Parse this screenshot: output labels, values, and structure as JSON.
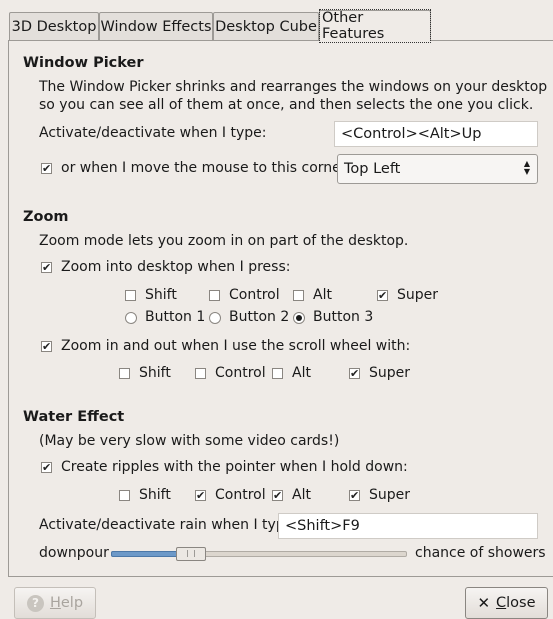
{
  "tabs": [
    {
      "label": "3D Desktop"
    },
    {
      "label": "Window Effects"
    },
    {
      "label": "Desktop Cube"
    },
    {
      "label": "Other Features",
      "active": true
    }
  ],
  "window_picker": {
    "title": "Window Picker",
    "description_line1": "The Window Picker shrinks and rearranges the windows on your desktop",
    "description_line2": "so you can see all of them at once, and then selects the one you click.",
    "activate_label": "Activate/deactivate when I type:",
    "activate_value": "<Control><Alt>Up",
    "corner_checked": true,
    "corner_label": "or when I move the mouse to this corner:",
    "corner_value": "Top Left"
  },
  "zoom": {
    "title": "Zoom",
    "description": "Zoom mode lets you zoom in on part of the desktop.",
    "press_checked": true,
    "press_label": "Zoom into desktop when I press:",
    "press_modifiers": [
      {
        "label": "Shift",
        "checked": false
      },
      {
        "label": "Control",
        "checked": false
      },
      {
        "label": "Alt",
        "checked": false
      },
      {
        "label": "Super",
        "checked": true
      }
    ],
    "press_buttons": [
      {
        "label": "Button 1",
        "selected": false
      },
      {
        "label": "Button 2",
        "selected": false
      },
      {
        "label": "Button 3",
        "selected": true
      }
    ],
    "scroll_checked": true,
    "scroll_label": "Zoom in and out when I use the scroll wheel with:",
    "scroll_modifiers": [
      {
        "label": "Shift",
        "checked": false
      },
      {
        "label": "Control",
        "checked": false
      },
      {
        "label": "Alt",
        "checked": false
      },
      {
        "label": "Super",
        "checked": true
      }
    ]
  },
  "water": {
    "title": "Water Effect",
    "note": "(May be very slow with some video cards!)",
    "ripples_checked": true,
    "ripples_label": "Create ripples with the pointer when I hold down:",
    "ripple_modifiers": [
      {
        "label": "Shift",
        "checked": false
      },
      {
        "label": "Control",
        "checked": true
      },
      {
        "label": "Alt",
        "checked": true
      },
      {
        "label": "Super",
        "checked": true
      }
    ],
    "rain_label": "Activate/deactivate rain when I type:",
    "rain_value": "<Shift>F9",
    "slider_left": "downpour",
    "slider_right": "chance of showers",
    "slider_fraction": 0.27
  },
  "buttons": {
    "help_label": "Help",
    "help_mnemonic": "H",
    "close_label": "Close",
    "close_mnemonic": "C"
  },
  "icons": {
    "help": "help-icon",
    "close": "close-x-icon",
    "combo_arrows": "up-down-arrows-icon",
    "check": "checkmark-icon"
  }
}
